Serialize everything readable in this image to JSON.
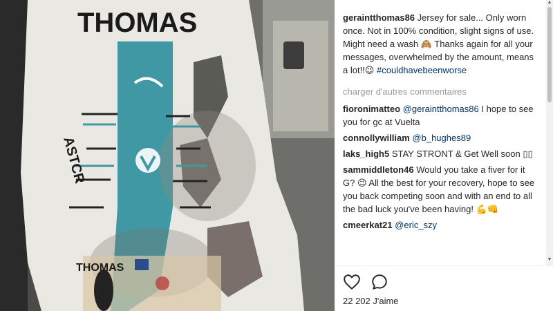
{
  "post": {
    "caption": {
      "username": "geraintthomas86",
      "text": "Jersey for sale... Only worn once. Not in 100% condition, slight signs of use. Might need a wash 🙈 Thanks again for all your messages, overwhelmed by the amount, means a lot!!😉",
      "hashtag": "#couldhavebeenworse"
    },
    "load_more_label": "charger d'autres commentaires",
    "comments": [
      {
        "username": "fioronimatteo",
        "mention": "@geraintthomas86",
        "text": "I hope to see you for gc at Vuelta"
      },
      {
        "username": "connollywilliam",
        "mention": "@b_hughes89",
        "text": ""
      },
      {
        "username": "laks_high5",
        "mention": "",
        "text": "STAY STRONT & Get Well soon ▯▯"
      },
      {
        "username": "sammiddleton46",
        "mention": "",
        "text": "Would you take a fiver for it G? 😉 All the best for your recovery, hope to see you back competing soon and with an end to all the bad luck you've been having! 💪👊"
      },
      {
        "username": "cmeerkat21",
        "mention": "@eric_szy",
        "text": ""
      }
    ],
    "likes_label": "22 202 J'aime",
    "icons": {
      "like": "heart-icon",
      "comment": "comment-bubble-icon"
    }
  },
  "photo": {
    "jersey_text_top": "THOMAS",
    "jersey_text_bottom": "THOMAS",
    "jersey_text_side": "ASTCR"
  }
}
